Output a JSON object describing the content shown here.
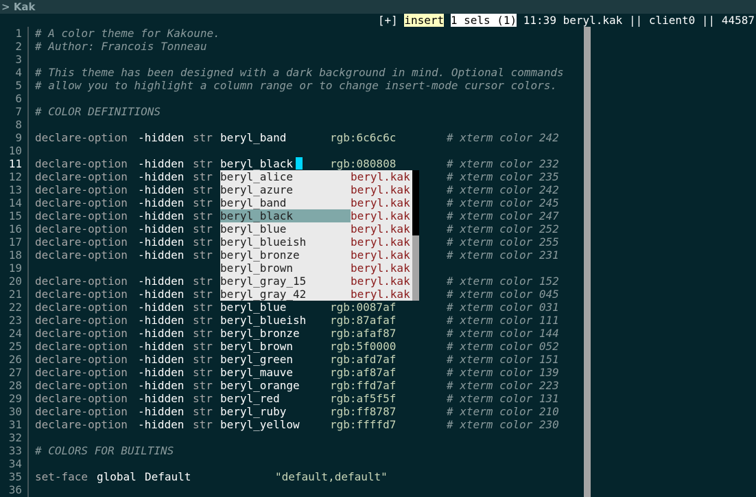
{
  "window": {
    "title": "Kak",
    "prompt_symbol": ">"
  },
  "modeline": {
    "modified": "[+]",
    "mode": "insert",
    "sels": "1 sels (1)",
    "position": "11:39",
    "buffer": "beryl.kak",
    "client": "client0",
    "session": "44587",
    "sep": "||"
  },
  "lines": [
    {
      "n": "1",
      "t": "comment",
      "text": "# A color theme for Kakoune."
    },
    {
      "n": "2",
      "t": "comment",
      "text": "# Author: Francois Tonneau"
    },
    {
      "n": "3",
      "t": "blank",
      "text": ""
    },
    {
      "n": "4",
      "t": "comment",
      "text": "# This theme has been designed with a dark background in mind. Optional commands"
    },
    {
      "n": "5",
      "t": "comment",
      "text": "# allow you to highlight a column range or to change insert-mode cursor colors."
    },
    {
      "n": "6",
      "t": "blank",
      "text": ""
    },
    {
      "n": "7",
      "t": "comment",
      "text": "# COLOR DEFINITIONS"
    },
    {
      "n": "8",
      "t": "blank",
      "text": ""
    },
    {
      "n": "9",
      "t": "decl",
      "name": "beryl_band",
      "rgb": "rgb:6c6c6c",
      "xterm": "# xterm color 242"
    },
    {
      "n": "10",
      "t": "blank",
      "text": ""
    },
    {
      "n": "11",
      "t": "decl",
      "name": "beryl_black",
      "rgb": "rgb:080808",
      "xterm": "# xterm color 232"
    },
    {
      "n": "12",
      "t": "decl",
      "name": "",
      "rgb": "",
      "xterm": "# xterm color 235"
    },
    {
      "n": "13",
      "t": "decl",
      "name": "",
      "rgb": "",
      "xterm": "# xterm color 242"
    },
    {
      "n": "14",
      "t": "decl",
      "name": "",
      "rgb": "",
      "xterm": "# xterm color 245"
    },
    {
      "n": "15",
      "t": "decl",
      "name": "",
      "rgb": "",
      "xterm": "# xterm color 247"
    },
    {
      "n": "16",
      "t": "decl",
      "name": "",
      "rgb": "",
      "xterm": "# xterm color 252"
    },
    {
      "n": "17",
      "t": "decl",
      "name": "",
      "rgb": "",
      "xterm": "# xterm color 255"
    },
    {
      "n": "18",
      "t": "decl",
      "name": "",
      "rgb": "",
      "xterm": "# xterm color 231"
    },
    {
      "n": "19",
      "t": "blank",
      "text": ""
    },
    {
      "n": "20",
      "t": "decl",
      "name": "",
      "rgb": "",
      "xterm": "# xterm color 152"
    },
    {
      "n": "21",
      "t": "decl",
      "name": "",
      "rgb": "",
      "xterm": "# xterm color 045"
    },
    {
      "n": "22",
      "t": "decl",
      "name": "beryl_blue",
      "rgb": "rgb:0087af",
      "xterm": "# xterm color 031"
    },
    {
      "n": "23",
      "t": "decl",
      "name": "beryl_blueish",
      "rgb": "rgb:87afaf",
      "xterm": "# xterm color 111"
    },
    {
      "n": "24",
      "t": "decl",
      "name": "beryl_bronze",
      "rgb": "rgb:afaf87",
      "xterm": "# xterm color 144"
    },
    {
      "n": "25",
      "t": "decl",
      "name": "beryl_brown",
      "rgb": "rgb:5f0000",
      "xterm": "# xterm color 052"
    },
    {
      "n": "26",
      "t": "decl",
      "name": "beryl_green",
      "rgb": "rgb:afd7af",
      "xterm": "# xterm color 151"
    },
    {
      "n": "27",
      "t": "decl",
      "name": "beryl_mauve",
      "rgb": "rgb:af87af",
      "xterm": "# xterm color 139"
    },
    {
      "n": "28",
      "t": "decl",
      "name": "beryl_orange",
      "rgb": "rgb:ffd7af",
      "xterm": "# xterm color 223"
    },
    {
      "n": "29",
      "t": "decl",
      "name": "beryl_red",
      "rgb": "rgb:af5f5f",
      "xterm": "# xterm color 131"
    },
    {
      "n": "30",
      "t": "decl",
      "name": "beryl_ruby",
      "rgb": "rgb:ff8787",
      "xterm": "# xterm color 210"
    },
    {
      "n": "31",
      "t": "decl",
      "name": "beryl_yellow",
      "rgb": "rgb:ffffd7",
      "xterm": "# xterm color 230"
    },
    {
      "n": "32",
      "t": "blank",
      "text": ""
    },
    {
      "n": "33",
      "t": "comment",
      "text": "# COLORS FOR BUILTINS"
    },
    {
      "n": "34",
      "t": "blank",
      "text": ""
    },
    {
      "n": "35",
      "t": "setface",
      "cmd": "set-face",
      "scope": "global",
      "face": "Default",
      "value": "\"default,default\""
    },
    {
      "n": "36",
      "t": "blank",
      "text": ""
    }
  ],
  "decl": {
    "cmd": "declare-option",
    "flag": "-hidden",
    "type": "str"
  },
  "completion": {
    "items": [
      {
        "name": "beryl_alice",
        "file": "beryl.kak"
      },
      {
        "name": "beryl_azure",
        "file": "beryl.kak"
      },
      {
        "name": "beryl_band",
        "file": "beryl.kak"
      },
      {
        "name": "beryl_black",
        "file": "beryl.kak",
        "selected": true
      },
      {
        "name": "beryl_blue",
        "file": "beryl.kak"
      },
      {
        "name": "beryl_blueish",
        "file": "beryl.kak"
      },
      {
        "name": "beryl_bronze",
        "file": "beryl.kak"
      },
      {
        "name": "beryl_brown",
        "file": "beryl.kak"
      },
      {
        "name": "beryl_gray_15",
        "file": "beryl.kak"
      },
      {
        "name": "beryl_gray_42",
        "file": "beryl.kak"
      }
    ]
  },
  "colors": {
    "background": "#05252c",
    "cursor": "#00d7ff",
    "selection": "#80a8a8"
  }
}
